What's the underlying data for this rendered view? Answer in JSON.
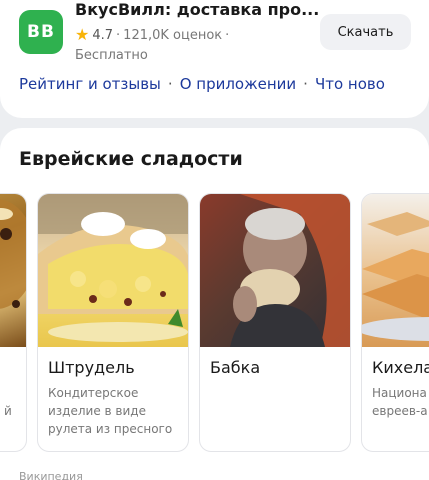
{
  "app": {
    "logo_text": "ВВ",
    "title": "ВкусВилл: доставка про...",
    "rating": "4.7",
    "reviews": "121,0K оценок",
    "price": "Бесплатно",
    "download_label": "Скачать",
    "tabs": [
      {
        "label": "Рейтинг и отзывы"
      },
      {
        "label": "О приложении"
      },
      {
        "label": "Что ново"
      }
    ],
    "colors": {
      "logo_bg": "#2fb14f",
      "star": "#f8b40a",
      "link": "#1d3a9c"
    }
  },
  "section": {
    "title": "Еврейские сладости",
    "cards": [
      {
        "title": "",
        "desc": "й",
        "image": "pastry-photo"
      },
      {
        "title": "Штрудель",
        "desc": "Кондитерское изделие в виде рулета из пресного",
        "image": "strudel-photo"
      },
      {
        "title": "Бабка",
        "desc": "",
        "image": "old-woman-eating-bread-photo"
      },
      {
        "title": "Кихела",
        "desc": "Национа песочно евреев-а",
        "image": "kihela-cookies-photo"
      }
    ],
    "source": "Википедия"
  }
}
